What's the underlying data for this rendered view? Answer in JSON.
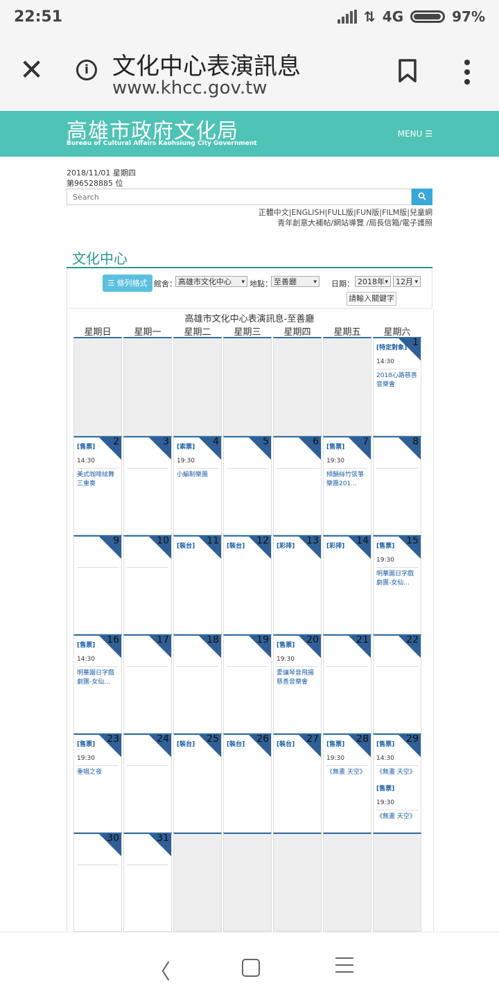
{
  "status": {
    "time": "22:51",
    "network": "4G",
    "battery": "97%"
  },
  "browser": {
    "title": "文化中心表演訊息",
    "url": "www.khcc.gov.tw"
  },
  "site": {
    "logo_cn": "高雄市政府文化局",
    "logo_en": "Bureau of Cultural Affairs Kaohsiung City Government",
    "menu_label": "MENU ☰"
  },
  "info": {
    "date": "2018/11/01 星期四",
    "visitors": "第96528885 位",
    "search_placeholder": "Search"
  },
  "links": {
    "line1": "正體中文|ENGLISH|FULL版|FUN版|FILM版|兒童網",
    "line2": "青年創意大補帖/網站導覽 /局長信箱/電子護照"
  },
  "section": {
    "title": "文化中心"
  },
  "filters": {
    "list_button": "☰ 條列格式",
    "venue_label": "館舍：",
    "venue_value": "高雄市文化中心",
    "place_label": "地點：",
    "place_value": "至善廳",
    "date_label": "日期：",
    "year_value": "2018年",
    "month_value": "12月",
    "keyword_button": "請輸入關鍵字"
  },
  "calendar": {
    "title": "高雄市文化中心表演訊息-至善廳",
    "weekdays": [
      "星期日",
      "星期一",
      "星期二",
      "星期三",
      "星期四",
      "星期五",
      "星期六"
    ],
    "weeks": [
      [
        {
          "day": "",
          "events": []
        },
        {
          "day": "",
          "events": []
        },
        {
          "day": "",
          "events": []
        },
        {
          "day": "",
          "events": []
        },
        {
          "day": "",
          "events": []
        },
        {
          "day": "",
          "events": []
        },
        {
          "day": "1",
          "events": [
            {
              "tag": "[特定對象]",
              "time": "14:30",
              "title": "2018心路慈善音樂會"
            }
          ]
        }
      ],
      [
        {
          "day": "2",
          "events": [
            {
              "tag": "[售票]",
              "time": "14:30",
              "title": "美式咖啡絃舞三重奏"
            }
          ]
        },
        {
          "day": "3",
          "events": []
        },
        {
          "day": "4",
          "events": [
            {
              "tag": "[索票]",
              "time": "19:30",
              "title": "小編制樂團"
            }
          ]
        },
        {
          "day": "5",
          "events": []
        },
        {
          "day": "6",
          "events": []
        },
        {
          "day": "7",
          "events": [
            {
              "tag": "[售票]",
              "time": "19:30",
              "title": "傾韻絲竹弦箏樂團201..."
            }
          ]
        },
        {
          "day": "8",
          "events": []
        }
      ],
      [
        {
          "day": "9",
          "events": []
        },
        {
          "day": "10",
          "events": []
        },
        {
          "day": "11",
          "events": [
            {
              "tag": "[裝台]",
              "time": "",
              "title": ""
            }
          ]
        },
        {
          "day": "12",
          "events": [
            {
              "tag": "[裝台]",
              "time": "",
              "title": ""
            }
          ]
        },
        {
          "day": "13",
          "events": [
            {
              "tag": "[彩排]",
              "time": "",
              "title": ""
            }
          ]
        },
        {
          "day": "14",
          "events": [
            {
              "tag": "[彩排]",
              "time": "",
              "title": ""
            }
          ]
        },
        {
          "day": "15",
          "events": [
            {
              "tag": "[售票]",
              "time": "19:30",
              "title": "明華園日字戲劇團-女仙..."
            }
          ]
        }
      ],
      [
        {
          "day": "16",
          "events": [
            {
              "tag": "[售票]",
              "time": "14:30",
              "title": "明華園日字戲劇團-女仙..."
            }
          ]
        },
        {
          "day": "17",
          "events": []
        },
        {
          "day": "18",
          "events": []
        },
        {
          "day": "19",
          "events": []
        },
        {
          "day": "20",
          "events": [
            {
              "tag": "[售票]",
              "time": "19:30",
              "title": "愛讓琴音飛揚慈善音樂會"
            }
          ]
        },
        {
          "day": "21",
          "events": []
        },
        {
          "day": "22",
          "events": []
        }
      ],
      [
        {
          "day": "23",
          "events": [
            {
              "tag": "[售票]",
              "time": "19:30",
              "title": "重唱之夜"
            }
          ]
        },
        {
          "day": "24",
          "events": []
        },
        {
          "day": "25",
          "events": [
            {
              "tag": "[裝台]",
              "time": "",
              "title": ""
            }
          ]
        },
        {
          "day": "26",
          "events": [
            {
              "tag": "[裝台]",
              "time": "",
              "title": ""
            }
          ]
        },
        {
          "day": "27",
          "events": [
            {
              "tag": "[裝台]",
              "time": "",
              "title": ""
            }
          ]
        },
        {
          "day": "28",
          "events": [
            {
              "tag": "[售票]",
              "time": "19:30",
              "title": "《無畫 天空》"
            }
          ]
        },
        {
          "day": "29",
          "events": [
            {
              "tag": "[售票]",
              "time": "14:30",
              "title": "《無畫 天空》"
            },
            {
              "tag": "[售票]",
              "time": "19:30",
              "title": "《無畫 天空》"
            }
          ]
        }
      ],
      [
        {
          "day": "30",
          "events": []
        },
        {
          "day": "31",
          "events": []
        },
        {
          "day": "",
          "events": []
        },
        {
          "day": "",
          "events": []
        },
        {
          "day": "",
          "events": []
        },
        {
          "day": "",
          "events": []
        },
        {
          "day": "",
          "events": []
        }
      ]
    ]
  }
}
